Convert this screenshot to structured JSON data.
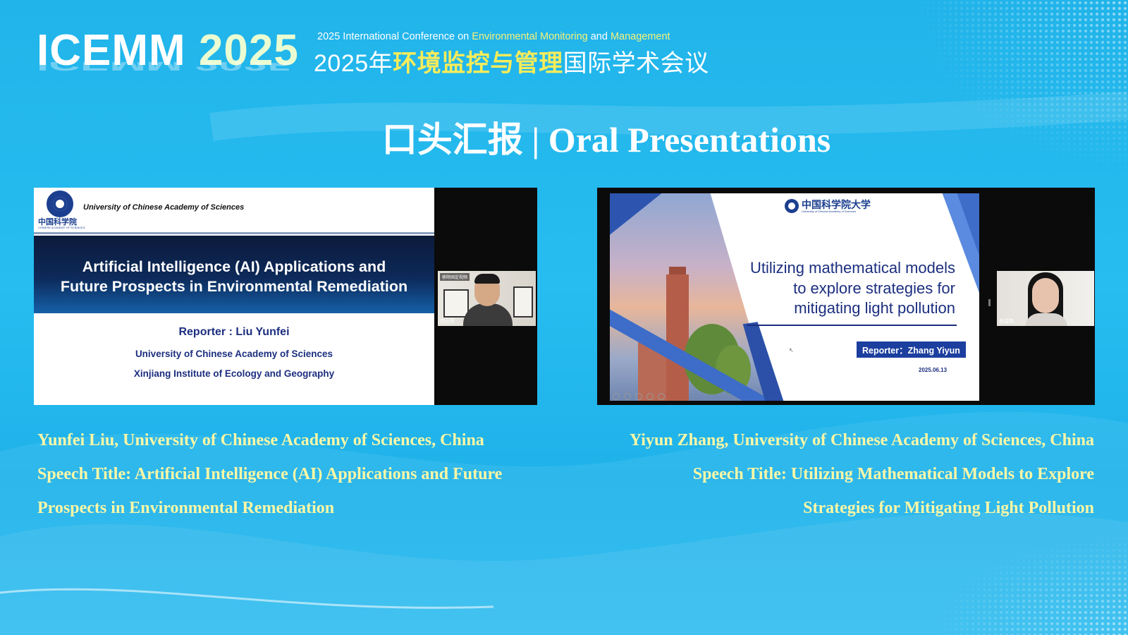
{
  "header": {
    "logo_text": "ICEMM",
    "logo_year": "2025",
    "conf_en_prefix": "2025 International Conference on ",
    "conf_en_hl1": "Environmental Monitoring",
    "conf_en_mid": " and ",
    "conf_en_hl2": "Management",
    "conf_cn_prefix": "2025年",
    "conf_cn_hl": "环境监控与管理",
    "conf_cn_suffix": "国际学术会议"
  },
  "section": {
    "title_cn": "口头汇报",
    "title_sep": " | ",
    "title_en": "Oral Presentations"
  },
  "presentations": [
    {
      "slide": {
        "institution_header": "University of Chinese Academy of Sciences",
        "logo_cn": "中国科学院",
        "logo_en": "CHINESE ACADEMY OF SCIENCES",
        "title_line1": "Artificial Intelligence (AI) Applications and",
        "title_line2": "Future Prospects in Environmental Remediation",
        "reporter": "Reporter : Liu Yunfei",
        "affiliation1": "University of Chinese Academy of Sciences",
        "affiliation2": "Xinjiang Institute of Ecology and Geography"
      },
      "camera": {
        "name_label": "刘云菲",
        "tag": "移除固定视频"
      },
      "caption": {
        "line1": "Yunfei Liu, University of Chinese Academy of Sciences, China",
        "line2": "Speech Title: Artificial Intelligence (AI) Applications and Future",
        "line3": "Prospects in Environmental Remediation"
      }
    },
    {
      "slide": {
        "logo_cn": "中国科学院大学",
        "logo_en": "University of Chinese Academy of Sciences",
        "title_line1": "Utilizing mathematical models",
        "title_line2": "to explore strategies for",
        "title_line3": "mitigating light pollution",
        "reporter": "Reporter：Zhang Yiyun",
        "date": "2025.06.13"
      },
      "camera": {
        "name_label": "张益韵"
      },
      "caption": {
        "line1": "Yiyun Zhang, University of Chinese Academy of Sciences, China",
        "line2": "Speech Title: Utilizing Mathematical Models to Explore",
        "line3": "Strategies for Mitigating Light Pollution"
      }
    }
  ],
  "colors": {
    "background": "#22b8ee",
    "caption": "#fbf7a6",
    "highlight": "#f7ec5a"
  }
}
